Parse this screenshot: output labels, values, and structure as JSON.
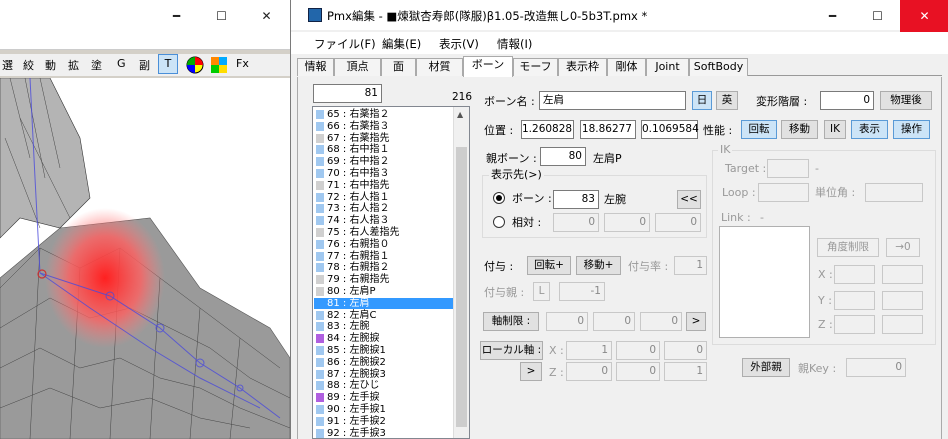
{
  "left_window": {
    "toolbar": [
      "選",
      "絞",
      "動",
      "拡",
      "塗",
      "G",
      "副",
      "T",
      "Fx"
    ]
  },
  "app": {
    "title": "Pmx編集 - ■煉獄杏寿郎(隊服)β1.05-改造無し0-5b3T.pmx *"
  },
  "menu": [
    "ファイル(F)",
    "編集(E)",
    "表示(V)",
    "情報(I)"
  ],
  "tabs": [
    "情報",
    "頂点",
    "面",
    "材質",
    "ボーン",
    "モーフ",
    "表示枠",
    "剛体",
    "Joint",
    "SoftBody"
  ],
  "active_tab": "ボーン",
  "list": {
    "index_value": "81",
    "count": "216",
    "selected": "81 : 左肩",
    "items": [
      {
        "t": "65 : 右薬指２",
        "c": "#a0c8f0"
      },
      {
        "t": "66 : 右薬指３",
        "c": "#a0c8f0"
      },
      {
        "t": "67 : 右薬指先",
        "c": "#d0d0d0"
      },
      {
        "t": "68 : 右中指１",
        "c": "#a0c8f0"
      },
      {
        "t": "69 : 右中指２",
        "c": "#a0c8f0"
      },
      {
        "t": "70 : 右中指３",
        "c": "#a0c8f0"
      },
      {
        "t": "71 : 右中指先",
        "c": "#d0d0d0"
      },
      {
        "t": "72 : 右人指１",
        "c": "#a0c8f0"
      },
      {
        "t": "73 : 右人指２",
        "c": "#a0c8f0"
      },
      {
        "t": "74 : 右人指３",
        "c": "#a0c8f0"
      },
      {
        "t": "75 : 右人差指先",
        "c": "#d0d0d0"
      },
      {
        "t": "76 : 右親指０",
        "c": "#a0c8f0"
      },
      {
        "t": "77 : 右親指１",
        "c": "#a0c8f0"
      },
      {
        "t": "78 : 右親指２",
        "c": "#a0c8f0"
      },
      {
        "t": "79 : 右親指先",
        "c": "#d0d0d0"
      },
      {
        "t": "80 : 左肩P",
        "c": "#d0d0d0"
      },
      {
        "t": "81 : 左肩",
        "c": "#3399ff"
      },
      {
        "t": "82 : 左肩C",
        "c": "#a0c8f0"
      },
      {
        "t": "83 : 左腕",
        "c": "#a0c8f0"
      },
      {
        "t": "84 : 左腕捩",
        "c": "#b060e0"
      },
      {
        "t": "85 : 左腕捩1",
        "c": "#a0c8f0"
      },
      {
        "t": "86 : 左腕捩2",
        "c": "#a0c8f0"
      },
      {
        "t": "87 : 左腕捩3",
        "c": "#a0c8f0"
      },
      {
        "t": "88 : 左ひじ",
        "c": "#a0c8f0"
      },
      {
        "t": "89 : 左手捩",
        "c": "#b060e0"
      },
      {
        "t": "90 : 左手捩1",
        "c": "#a0c8f0"
      },
      {
        "t": "91 : 左手捩2",
        "c": "#a0c8f0"
      },
      {
        "t": "92 : 左手捩3",
        "c": "#a0c8f0"
      }
    ]
  },
  "bone": {
    "name_label": "ボーン名 :",
    "name": "左肩",
    "lang_jp": "日",
    "lang_en": "英",
    "layer_label": "変形階層 :",
    "layer": "0",
    "after_physics": "物理後",
    "pos_label": "位置 :",
    "pos": [
      "1.260828",
      "18.86277",
      "0.1069584"
    ],
    "perf_label": "性能 :",
    "perf": [
      "回転",
      "移動",
      "IK",
      "表示",
      "操作"
    ],
    "parent_label": "親ボーン :",
    "parent_idx": "80",
    "parent_name": "左肩P",
    "tip_group": "表示先(>)",
    "tip_bone_label": "ボーン :",
    "tip_idx": "83",
    "tip_name": "左腕",
    "tip_btn": "<<",
    "tip_rel_label": "相対 :",
    "tip_rel": [
      "0",
      "0",
      "0"
    ],
    "grant_label": "付与 :",
    "grant_rot": "回転+",
    "grant_move": "移動+",
    "grant_rate_label": "付与率 :",
    "grant_rate": "1",
    "grant_parent_label": "付与親 :",
    "grant_parent_btn": "L",
    "grant_parent": "-1",
    "axis_label": "軸制限 :",
    "axis": [
      "0",
      "0",
      "0"
    ],
    "arrow": ">",
    "local_label": "ローカル軸 :",
    "local_x_label": "X :",
    "local_x": [
      "1",
      "0",
      "0"
    ],
    "local_z_label": "Z :",
    "local_z": [
      "0",
      "0",
      "1"
    ],
    "ext_parent": "外部親",
    "key_label": "親Key :",
    "key": "0"
  },
  "ik": {
    "title": "IK",
    "target_label": "Target :",
    "target_dash": "-",
    "loop_label": "Loop :",
    "unit_label": "単位角 :",
    "link_label": "Link :",
    "link_dash": "-",
    "angle_btn": "角度制限",
    "to_btn": "→0",
    "x": "X :",
    "y": "Y :",
    "z": "Z :"
  }
}
